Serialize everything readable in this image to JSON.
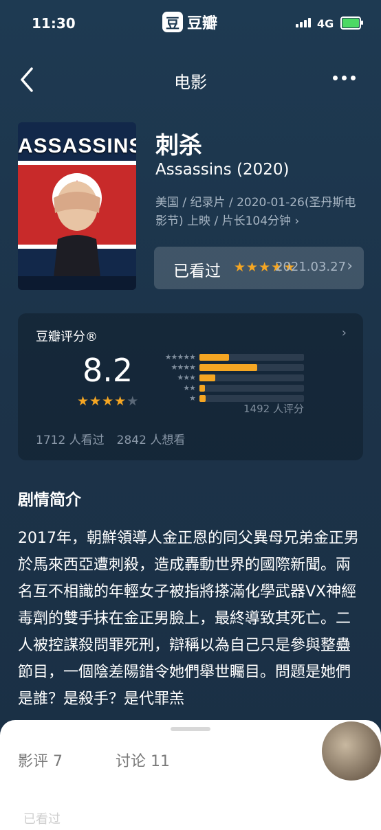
{
  "status_bar": {
    "time": "11:30",
    "network": "4G"
  },
  "brand": {
    "logo_char": "豆",
    "name": "豆瓣"
  },
  "nav": {
    "title": "电影"
  },
  "movie": {
    "poster_text": "ASSASSINS",
    "title": "刺杀",
    "subtitle": "Assassins (2020)",
    "meta": "美国 / 纪录片 / 2020-01-26(圣丹斯电影节) 上映 / 片长104分钟 ›"
  },
  "watched": {
    "label": "已看过",
    "rating_stars": 5,
    "date": "2021.03.27"
  },
  "rating": {
    "label": "豆瓣评分®",
    "score": "8.2",
    "stars": 4,
    "distribution": [
      {
        "stars": "★★★★★",
        "fraction": 0.28
      },
      {
        "stars": "★★★★",
        "fraction": 0.55
      },
      {
        "stars": "★★★",
        "fraction": 0.15
      },
      {
        "stars": "★★",
        "fraction": 0.05
      },
      {
        "stars": "★",
        "fraction": 0.06
      }
    ],
    "count": "1492 人评分",
    "watched_count": "1712 人看过",
    "want_count": "2842 人想看"
  },
  "synopsis": {
    "title": "剧情简介",
    "body": "2017年，朝鮮領導人金正恩的同父異母兄弟金正男於馬來西亞遭刺殺，造成轟動世界的國際新聞。兩名互不相識的年輕女子被指將搽滿化學武器VX神經毒劑的雙手抹在金正男臉上，最終導致其死亡。二人被控謀殺問罪死刑，辯稱以為自己只是參與整蠱節目，一個陰差陽錯令她們舉世矚目。問題是她們是誰？是殺手？是代罪羔"
  },
  "sheet": {
    "tabs": [
      "影评 7",
      "讨论 11"
    ],
    "next_label": "已看过"
  },
  "colors": {
    "accent": "#f5a623",
    "background": "#1c3349"
  }
}
